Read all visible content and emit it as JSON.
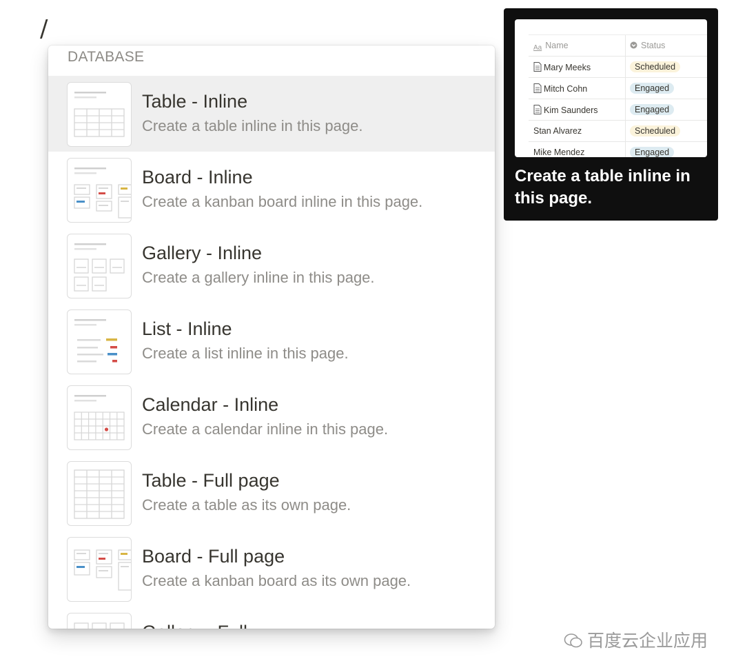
{
  "command_text": "/",
  "menu": {
    "section_label": "DATABASE",
    "items": [
      {
        "title": "Table - Inline",
        "desc": "Create a table inline in this page.",
        "icon": "table-inline-icon"
      },
      {
        "title": "Board - Inline",
        "desc": "Create a kanban board inline in this page.",
        "icon": "board-inline-icon"
      },
      {
        "title": "Gallery - Inline",
        "desc": "Create a gallery inline in this page.",
        "icon": "gallery-inline-icon"
      },
      {
        "title": "List - Inline",
        "desc": "Create a list inline in this page.",
        "icon": "list-inline-icon"
      },
      {
        "title": "Calendar - Inline",
        "desc": "Create a calendar inline in this page.",
        "icon": "calendar-inline-icon"
      },
      {
        "title": "Table - Full page",
        "desc": "Create a table as its own page.",
        "icon": "table-fullpage-icon"
      },
      {
        "title": "Board - Full page",
        "desc": "Create a kanban board as its own page.",
        "icon": "board-fullpage-icon"
      },
      {
        "title": "Gallery - Full",
        "desc": "",
        "icon": "gallery-fullpage-icon"
      }
    ],
    "selected_index": 0
  },
  "preview": {
    "table": {
      "headers": {
        "name": "Name",
        "status": "Status"
      },
      "rows": [
        {
          "name": "Mary Meeks",
          "status": "Scheduled"
        },
        {
          "name": "Mitch Cohn",
          "status": "Engaged"
        },
        {
          "name": "Kim Saunders",
          "status": "Engaged"
        },
        {
          "name": "Stan Alvarez",
          "status": "Scheduled"
        },
        {
          "name": "Mike Mendez",
          "status": "Engaged"
        }
      ]
    },
    "caption": "Create a table inline in this page."
  },
  "watermark": "百度云企业应用",
  "colors": {
    "selected_bg": "#efefef",
    "scheduled_tag": "#fbf3db",
    "engaged_tag": "#ddebf1",
    "preview_bg": "#0f0f0f"
  }
}
